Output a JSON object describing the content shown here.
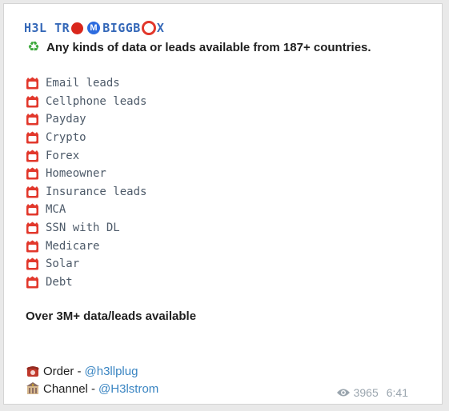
{
  "header": {
    "title_part1": "H3L TR",
    "title_part2": "BIGGB",
    "title_part3": "X",
    "tagline": "Any kinds of data or leads available from 187+ countries."
  },
  "leads": [
    {
      "label": "Email leads"
    },
    {
      "label": "Cellphone leads"
    },
    {
      "label": "Payday"
    },
    {
      "label": "Crypto"
    },
    {
      "label": "Forex"
    },
    {
      "label": "Homeowner"
    },
    {
      "label": "Insurance leads"
    },
    {
      "label": "MCA"
    },
    {
      "label": "SSN with DL"
    },
    {
      "label": "Medicare"
    },
    {
      "label": "Solar"
    },
    {
      "label": "Debt"
    }
  ],
  "summary": "Over 3M+ data/leads available",
  "contacts": {
    "order_label": "Order -",
    "order_handle": "@h3llplug",
    "channel_label": "Channel -",
    "channel_handle": "@H3lstrom"
  },
  "meta": {
    "views": "3965",
    "time": "6:41"
  },
  "colors": {
    "title": "#3568b8",
    "link": "#3a85c2",
    "lead_text": "#4d5a69",
    "badge_red": "#e2382c",
    "meta": "#9aa5ae"
  }
}
